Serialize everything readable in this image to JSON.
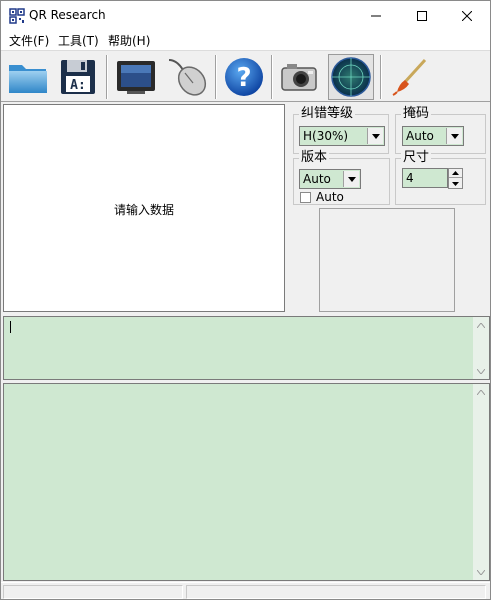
{
  "window": {
    "title": "QR Research"
  },
  "menu": {
    "items": [
      "文件(F)",
      "工具(T)",
      "帮助(H)"
    ]
  },
  "toolbar": {
    "buttons": [
      "open-folder-icon",
      "save-floppy-icon",
      "monitor-icon",
      "mouse-icon",
      "help-icon",
      "camera-icon",
      "radar-icon",
      "brush-icon"
    ]
  },
  "input": {
    "hint": "请输入数据"
  },
  "panel": {
    "ecc": {
      "label": "纠错等级",
      "value": "H(30%)"
    },
    "mask": {
      "label": "掩码",
      "value": "Auto"
    },
    "version": {
      "label": "版本",
      "value": "Auto",
      "checkbox_label": "Auto"
    },
    "size": {
      "label": "尺寸",
      "value": "4"
    }
  },
  "colors": {
    "field_bg": "#cfe8d1",
    "window_bg": "#f0f0f0"
  }
}
